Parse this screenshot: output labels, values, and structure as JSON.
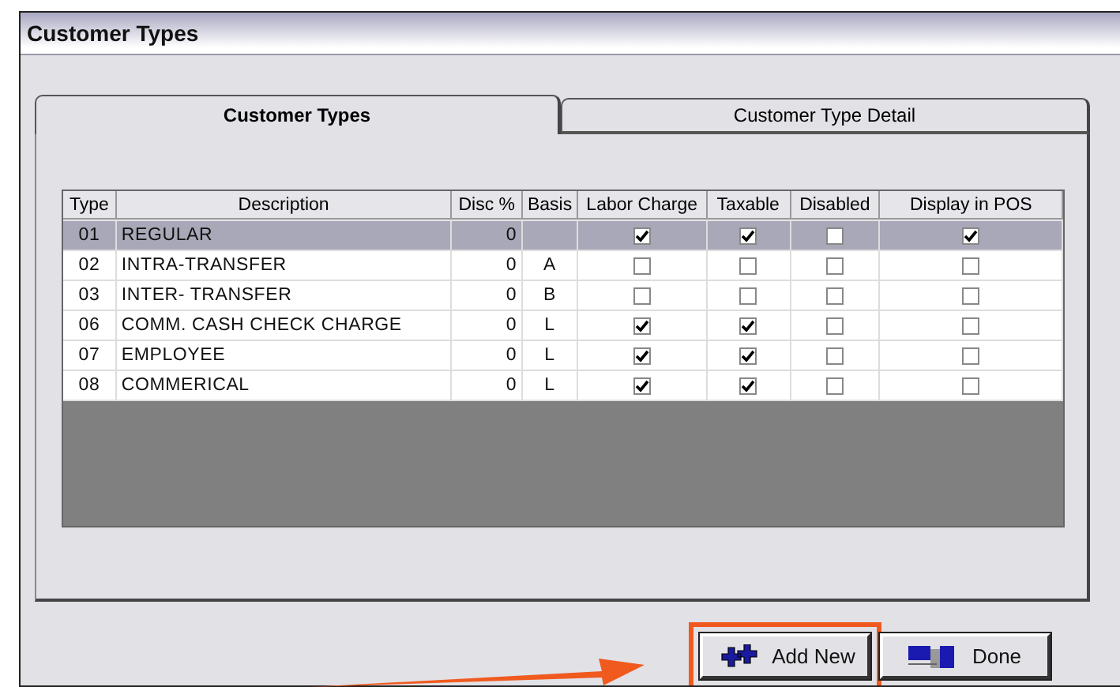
{
  "window": {
    "title": "Customer Types"
  },
  "tabs": [
    {
      "label": "Customer Types",
      "selected": true
    },
    {
      "label": "Customer Type Detail",
      "selected": false
    }
  ],
  "table": {
    "columns": [
      "Type",
      "Description",
      "Disc %",
      "Basis",
      "Labor Charge",
      "Taxable",
      "Disabled",
      "Display in POS"
    ],
    "rows": [
      {
        "type": "01",
        "description": "REGULAR",
        "disc": "0",
        "basis": "",
        "labor_charge": true,
        "taxable": true,
        "disabled": false,
        "display_in_pos": true,
        "selected": true
      },
      {
        "type": "02",
        "description": "INTRA-TRANSFER",
        "disc": "0",
        "basis": "A",
        "labor_charge": false,
        "taxable": false,
        "disabled": false,
        "display_in_pos": false,
        "selected": false
      },
      {
        "type": "03",
        "description": "INTER- TRANSFER",
        "disc": "0",
        "basis": "B",
        "labor_charge": false,
        "taxable": false,
        "disabled": false,
        "display_in_pos": false,
        "selected": false
      },
      {
        "type": "06",
        "description": "COMM. CASH CHECK CHARGE",
        "disc": "0",
        "basis": "L",
        "labor_charge": true,
        "taxable": true,
        "disabled": false,
        "display_in_pos": false,
        "selected": false
      },
      {
        "type": "07",
        "description": "EMPLOYEE",
        "disc": "0",
        "basis": "L",
        "labor_charge": true,
        "taxable": true,
        "disabled": false,
        "display_in_pos": false,
        "selected": false
      },
      {
        "type": "08",
        "description": "COMMERICAL",
        "disc": "0",
        "basis": "L",
        "labor_charge": true,
        "taxable": true,
        "disabled": false,
        "display_in_pos": false,
        "selected": false
      }
    ]
  },
  "buttons": [
    {
      "label": "Add New",
      "kind": "add",
      "highlighted": true
    },
    {
      "label": "Done",
      "kind": "done",
      "highlighted": false
    }
  ]
}
